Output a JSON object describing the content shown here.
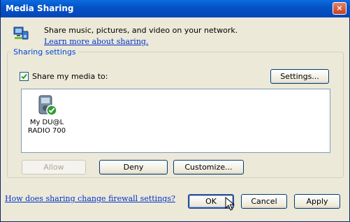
{
  "window": {
    "title": "Media Sharing",
    "close_label": "×"
  },
  "header": {
    "description": "Share music, pictures, and video on your network.",
    "learn_more": "Learn more about sharing."
  },
  "sharing_settings": {
    "legend": "Sharing settings",
    "share_checkbox_label": "Share my media to:",
    "share_checked": true,
    "settings_button": "Settings...",
    "devices": [
      {
        "name_line1": "My DU@L",
        "name_line2": "RADIO 700",
        "icon": "media-device-allowed-icon"
      }
    ],
    "allow_button": "Allow",
    "deny_button": "Deny",
    "customize_button": "Customize..."
  },
  "footer": {
    "firewall_link": "How does sharing change firewall settings?",
    "ok_button": "OK",
    "cancel_button": "Cancel",
    "apply_button": "Apply"
  },
  "colors": {
    "titlebar": "#0553c6",
    "link": "#0033cc",
    "legend": "#0046d5",
    "face": "#ece9d8"
  }
}
